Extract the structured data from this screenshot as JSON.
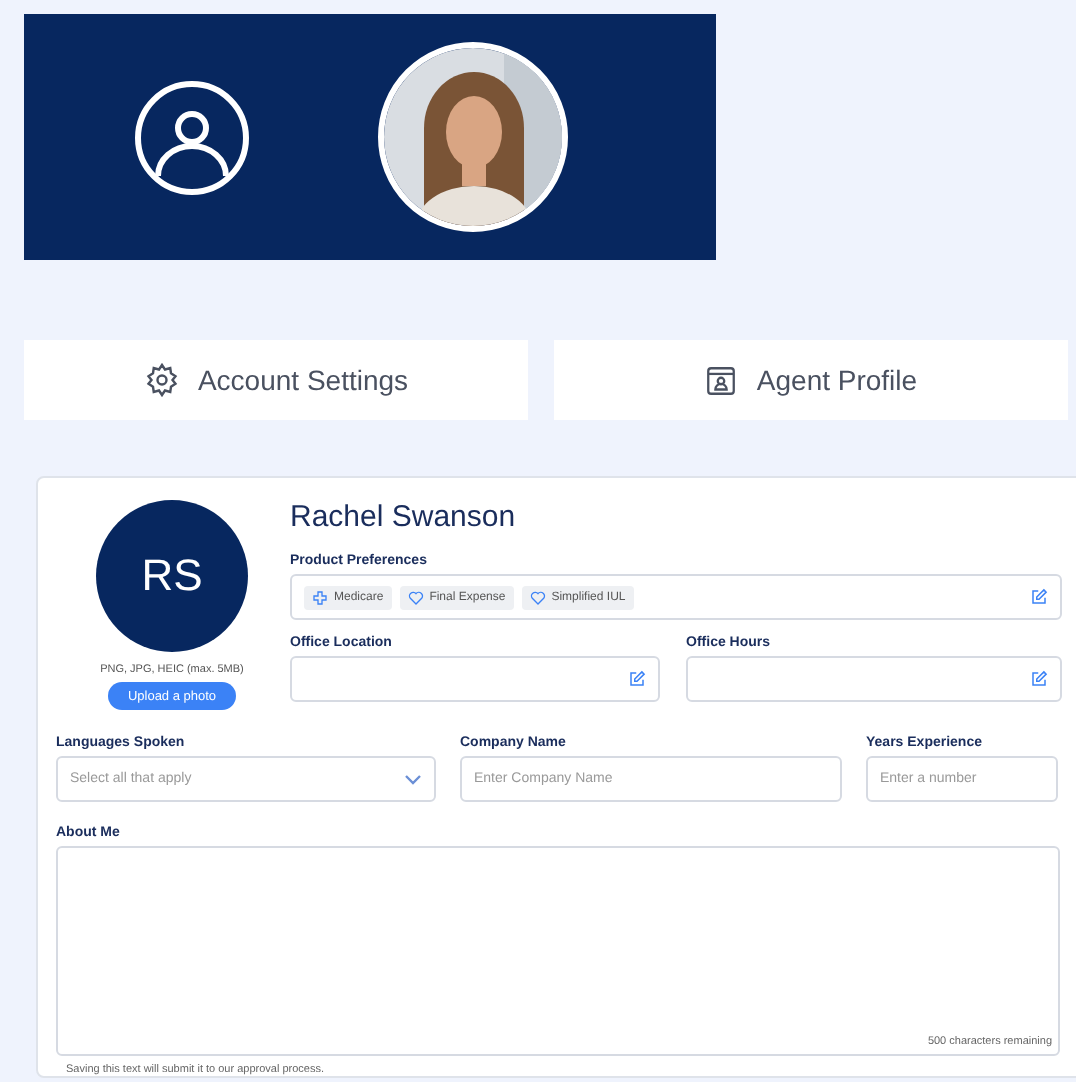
{
  "tabs": [
    {
      "label": "Account Settings",
      "selected": false
    },
    {
      "label": "Agent Profile",
      "selected": false
    }
  ],
  "profile": {
    "initials": "RS",
    "photo_hint": "PNG, JPG, HEIC (max. 5MB)",
    "upload_button": "Upload a photo",
    "name": "Rachel Swanson"
  },
  "product_preferences": {
    "label": "Product Preferences",
    "chips": [
      {
        "label": "Medicare",
        "kind": "cross"
      },
      {
        "label": "Final Expense",
        "kind": "heart"
      },
      {
        "label": "Simplified IUL",
        "kind": "heart"
      }
    ]
  },
  "office_location": {
    "label": "Office Location"
  },
  "office_hours": {
    "label": "Office Hours"
  },
  "languages": {
    "label": "Languages Spoken",
    "placeholder": "Select all that apply"
  },
  "company": {
    "label": "Company Name",
    "placeholder": "Enter Company Name"
  },
  "years": {
    "label": "Years Experience",
    "placeholder": "Enter a number"
  },
  "about": {
    "label": "About Me",
    "counter": "500 characters remaining",
    "note": "Saving this text will submit it to our approval process."
  }
}
